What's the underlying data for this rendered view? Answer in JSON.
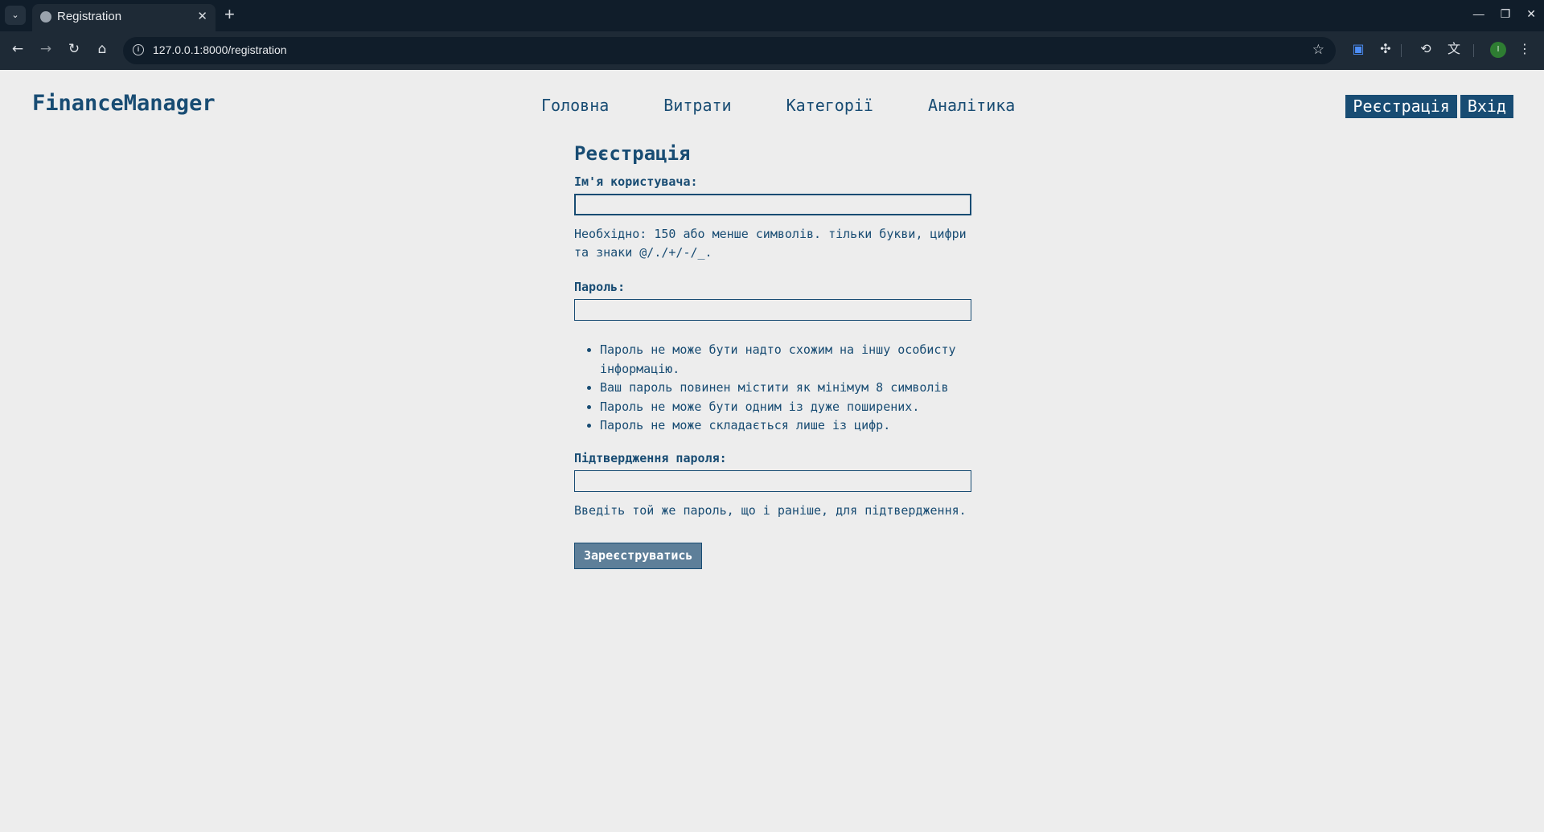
{
  "browser": {
    "tab_title": "Registration",
    "url": "127.0.0.1:8000/registration",
    "profile_initial": "I",
    "icons": {
      "tab_list": "chevron-down-icon",
      "favicon": "globe-icon",
      "tab_close": "close-icon",
      "new_tab": "plus-icon",
      "back": "arrow-left-icon",
      "forward": "arrow-right-icon",
      "reload": "reload-icon",
      "home": "home-icon",
      "site_info": "info-icon",
      "bookmark": "star-icon",
      "extension_1": "cast-icon",
      "extension_2": "puzzle-icon",
      "history": "history-icon",
      "translate": "translate-icon",
      "menu": "kebab-menu-icon"
    }
  },
  "header": {
    "logo": "FinanceManager",
    "nav": [
      "Головна",
      "Витрати",
      "Категорії",
      "Аналітика"
    ],
    "register_label": "Реєстрація",
    "login_label": "Вхід"
  },
  "form": {
    "title": "Реєстрація",
    "username_label": "Ім'я користувача:",
    "username_help": "Необхідно: 150 або менше символів. тільки букви, цифри та знаки @/./+/-/_.",
    "password_label": "Пароль:",
    "password_rules": [
      "Пароль не може бути надто схожим на іншу особисту інформацію.",
      "Ваш пароль повинен містити як мінімум 8 символів",
      "Пароль не може бути одним із дуже поширених.",
      "Пароль не може складається лише із цифр."
    ],
    "confirm_label": "Підтвердження пароля:",
    "confirm_help": "Введіть той же пароль, що і раніше, для підтвердження.",
    "submit_label": "Зареєструватись"
  },
  "colors": {
    "primary": "#184c73",
    "page_bg": "#ededed",
    "submit_bg": "#5e7f99",
    "chrome_dark": "#101d2a",
    "chrome_toolbar": "#1e2a36"
  }
}
